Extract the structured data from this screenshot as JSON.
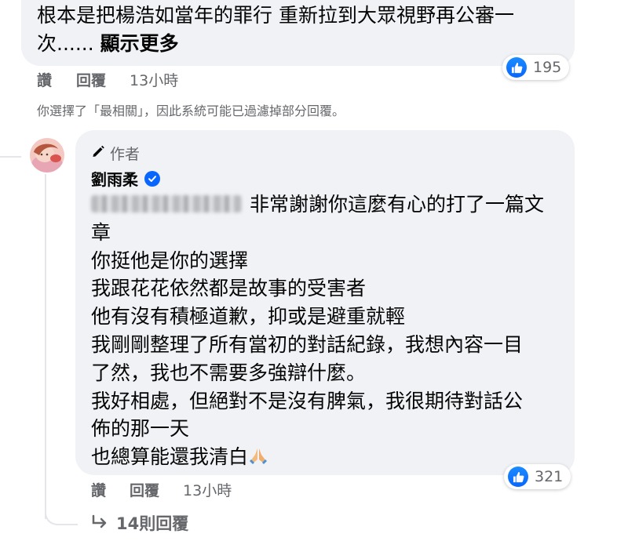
{
  "top_comment": {
    "text": "根本是把楊浩如當年的罪行 重新拉到大眾視野再公審一",
    "text_cont": "次......",
    "see_more": "顯示更多",
    "like_label": "讚",
    "reply_label": "回覆",
    "time": "13小時",
    "reaction_count": "195"
  },
  "filter_note": "你選擇了「最相關」，因此系統可能已過濾掉部分回覆。",
  "author_reply": {
    "badge": "作者",
    "name": "劉雨柔",
    "lines": [
      "非常謝謝你這麼有心的打了一篇文",
      "章",
      "你挺他是你的選擇",
      "我跟花花依然都是故事的受害者",
      "他有沒有積極道歉，抑或是避重就輕",
      "我剛剛整理了所有當初的對話紀錄，我想內容一目",
      "了然，我也不需要多強辯什麼。",
      "我好相處，但絕對不是沒有脾氣，我很期待對話公",
      "佈的那一天",
      "也總算能還我清白"
    ],
    "like_label": "讚",
    "reply_label": "回覆",
    "time": "13小時",
    "reaction_count": "321"
  },
  "view_replies": "14則回覆",
  "colors": {
    "bubble": "#f0f2f5",
    "meta_text": "#65676b",
    "like_blue": "#0866ff"
  },
  "icons": [
    "like-icon",
    "pencil-icon",
    "verified-icon",
    "praying-hands-icon",
    "reply-arrow-icon"
  ]
}
